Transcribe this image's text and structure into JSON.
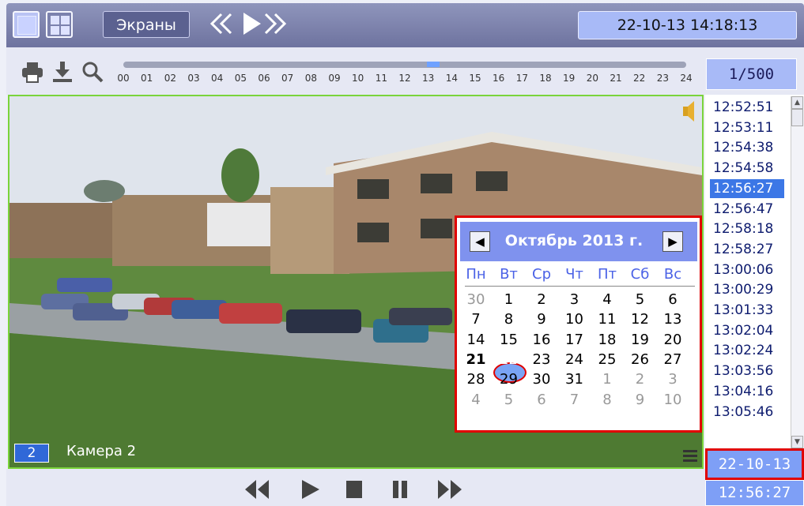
{
  "toolbar": {
    "screens_label": "Экраны",
    "prev_icon": "double-chevron-left-icon",
    "play_icon": "play-icon",
    "next_icon": "double-chevron-right-icon",
    "datetime": "22-10-13  14:18:13"
  },
  "timeline": {
    "hours": [
      "00",
      "01",
      "02",
      "03",
      "04",
      "05",
      "06",
      "07",
      "08",
      "09",
      "10",
      "11",
      "12",
      "13",
      "14",
      "15",
      "16",
      "17",
      "18",
      "19",
      "20",
      "21",
      "22",
      "23",
      "24"
    ],
    "position_fraction": 0.55,
    "counter": "1/500"
  },
  "camera": {
    "number": "2",
    "name": "Камера 2"
  },
  "calendar": {
    "title": "Октябрь 2013 г.",
    "weekdays": [
      "Пн",
      "Вт",
      "Ср",
      "Чт",
      "Пт",
      "Сб",
      "Вс"
    ],
    "weeks": [
      [
        {
          "d": "30",
          "o": true
        },
        {
          "d": "1"
        },
        {
          "d": "2"
        },
        {
          "d": "3"
        },
        {
          "d": "4"
        },
        {
          "d": "5"
        },
        {
          "d": "6"
        }
      ],
      [
        {
          "d": "7"
        },
        {
          "d": "8"
        },
        {
          "d": "9"
        },
        {
          "d": "10"
        },
        {
          "d": "11"
        },
        {
          "d": "12"
        },
        {
          "d": "13"
        }
      ],
      [
        {
          "d": "14"
        },
        {
          "d": "15"
        },
        {
          "d": "16"
        },
        {
          "d": "17"
        },
        {
          "d": "18"
        },
        {
          "d": "19"
        },
        {
          "d": "20"
        }
      ],
      [
        {
          "d": "21",
          "today": true
        },
        {
          "d": "22",
          "sel": true
        },
        {
          "d": "23"
        },
        {
          "d": "24"
        },
        {
          "d": "25"
        },
        {
          "d": "26"
        },
        {
          "d": "27"
        }
      ],
      [
        {
          "d": "28"
        },
        {
          "d": "29"
        },
        {
          "d": "30"
        },
        {
          "d": "31"
        },
        {
          "d": "1",
          "o": true
        },
        {
          "d": "2",
          "o": true
        },
        {
          "d": "3",
          "o": true
        }
      ],
      [
        {
          "d": "4",
          "o": true
        },
        {
          "d": "5",
          "o": true
        },
        {
          "d": "6",
          "o": true
        },
        {
          "d": "7",
          "o": true
        },
        {
          "d": "8",
          "o": true
        },
        {
          "d": "9",
          "o": true
        },
        {
          "d": "10",
          "o": true
        }
      ]
    ]
  },
  "times": [
    "12:52:51",
    "12:53:11",
    "12:54:38",
    "12:54:58",
    "12:56:27",
    "12:56:47",
    "12:58:18",
    "12:58:27",
    "13:00:06",
    "13:00:29",
    "13:01:33",
    "13:02:04",
    "13:02:24",
    "13:03:56",
    "13:04:16",
    "13:05:46"
  ],
  "selected_time_index": 4,
  "current": {
    "date": "22-10-13",
    "time": "12:56:27"
  },
  "colors": {
    "selection": "#3c77e6",
    "highlight_border": "#e00000",
    "video_border": "#7ad43b"
  }
}
